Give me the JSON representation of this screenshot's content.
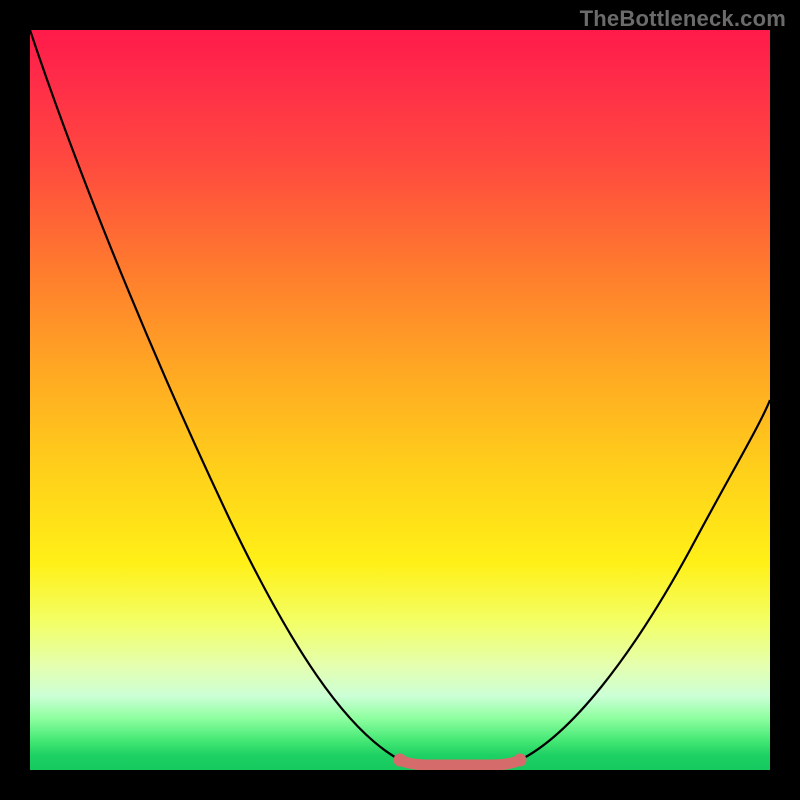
{
  "watermark": "TheBottleneck.com",
  "chart_data": {
    "type": "line",
    "title": "",
    "xlabel": "",
    "ylabel": "",
    "xlim": [
      0,
      100
    ],
    "ylim": [
      0,
      100
    ],
    "series": [
      {
        "name": "curve",
        "x": [
          0,
          10,
          20,
          30,
          40,
          47,
          52,
          58,
          63,
          67,
          75,
          85,
          95,
          100
        ],
        "values": [
          100,
          80,
          62,
          45,
          28,
          13,
          3,
          1,
          1,
          3,
          13,
          28,
          42,
          50
        ]
      }
    ],
    "flat_bottom": {
      "x_start": 52,
      "x_end": 63,
      "y": 1
    },
    "gradient_stops": [
      {
        "pos": 0,
        "color": "#ff1a4a"
      },
      {
        "pos": 18,
        "color": "#ff4a3f"
      },
      {
        "pos": 46,
        "color": "#ffa823"
      },
      {
        "pos": 72,
        "color": "#fff017"
      },
      {
        "pos": 90,
        "color": "#ccffd6"
      },
      {
        "pos": 100,
        "color": "#16c95f"
      }
    ],
    "accent_color": "#d66b6b",
    "curve_color": "#000000"
  }
}
